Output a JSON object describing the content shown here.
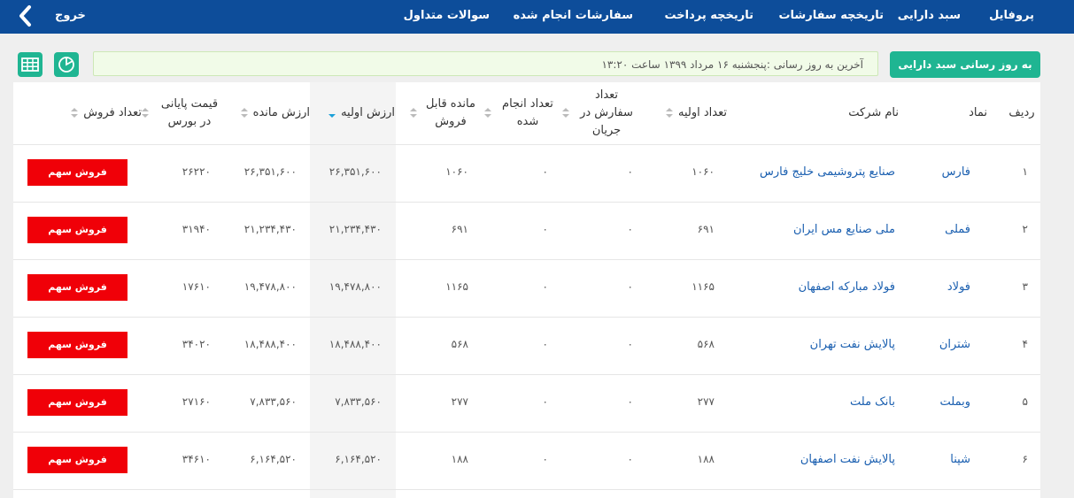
{
  "nav": {
    "profile": "پروفایل",
    "portfolio": "سبد دارایی",
    "order_history": "تاریخچه سفارشات",
    "payment_history": "تاریخچه پرداخت",
    "completed_orders": "سفارشات انجام شده",
    "faq": "سوالات متداول",
    "logout": "خروج"
  },
  "toolbar": {
    "refresh_label": "به روز رسانی سبد دارایی",
    "last_update": "آخرین به روز رسانی :پنجشنبه ۱۶ مرداد ۱۳۹۹ ساعت ۱۳:۲۰"
  },
  "table": {
    "headers": {
      "row": "ردیف",
      "symbol": "نماد",
      "company": "نام شرکت",
      "initial_count": "تعداد اولیه",
      "pending_orders": "تعداد سفارش در جریان",
      "completed_count": "تعداد انجام شده",
      "sellable_remaining": "مانده قابل فروش",
      "initial_value": "ارزش اولیه",
      "remaining_value": "ارزش مانده",
      "last_price": "قیمت پایانی در بورس",
      "sell_count": "تعداد فروش"
    },
    "sell_label": "فروش سهم",
    "rows": [
      {
        "row": "۱",
        "symbol": "فارس",
        "company": "صنایع پتروشیمی خلیج فارس",
        "initial_count": "۱۰۶۰",
        "pending": "۰",
        "completed": "۰",
        "sellable": "۱۰۶۰",
        "initial_value": "۲۶,۳۵۱,۶۰۰",
        "remaining_value": "۲۶,۳۵۱,۶۰۰",
        "last_price": "۲۶۲۲۰"
      },
      {
        "row": "۲",
        "symbol": "فملی",
        "company": "ملی صنایع مس ایران",
        "initial_count": "۶۹۱",
        "pending": "۰",
        "completed": "۰",
        "sellable": "۶۹۱",
        "initial_value": "۲۱,۲۳۴,۴۳۰",
        "remaining_value": "۲۱,۲۳۴,۴۳۰",
        "last_price": "۳۱۹۴۰"
      },
      {
        "row": "۳",
        "symbol": "فولاد",
        "company": "فولاد مبارکه اصفهان",
        "initial_count": "۱۱۶۵",
        "pending": "۰",
        "completed": "۰",
        "sellable": "۱۱۶۵",
        "initial_value": "۱۹,۴۷۸,۸۰۰",
        "remaining_value": "۱۹,۴۷۸,۸۰۰",
        "last_price": "۱۷۶۱۰"
      },
      {
        "row": "۴",
        "symbol": "شتران",
        "company": "پالایش نفت تهران",
        "initial_count": "۵۶۸",
        "pending": "۰",
        "completed": "۰",
        "sellable": "۵۶۸",
        "initial_value": "۱۸,۴۸۸,۴۰۰",
        "remaining_value": "۱۸,۴۸۸,۴۰۰",
        "last_price": "۳۴۰۲۰"
      },
      {
        "row": "۵",
        "symbol": "وبملت",
        "company": "بانک ملت",
        "initial_count": "۲۷۷",
        "pending": "۰",
        "completed": "۰",
        "sellable": "۲۷۷",
        "initial_value": "۷,۸۳۳,۵۶۰",
        "remaining_value": "۷,۸۳۳,۵۶۰",
        "last_price": "۲۷۱۶۰"
      },
      {
        "row": "۶",
        "symbol": "شپنا",
        "company": "پالایش نفت اصفهان",
        "initial_count": "۱۸۸",
        "pending": "۰",
        "completed": "۰",
        "sellable": "۱۸۸",
        "initial_value": "۶,۱۶۴,۵۲۰",
        "remaining_value": "۶,۱۶۴,۵۲۰",
        "last_price": "۳۴۶۱۰"
      }
    ]
  }
}
